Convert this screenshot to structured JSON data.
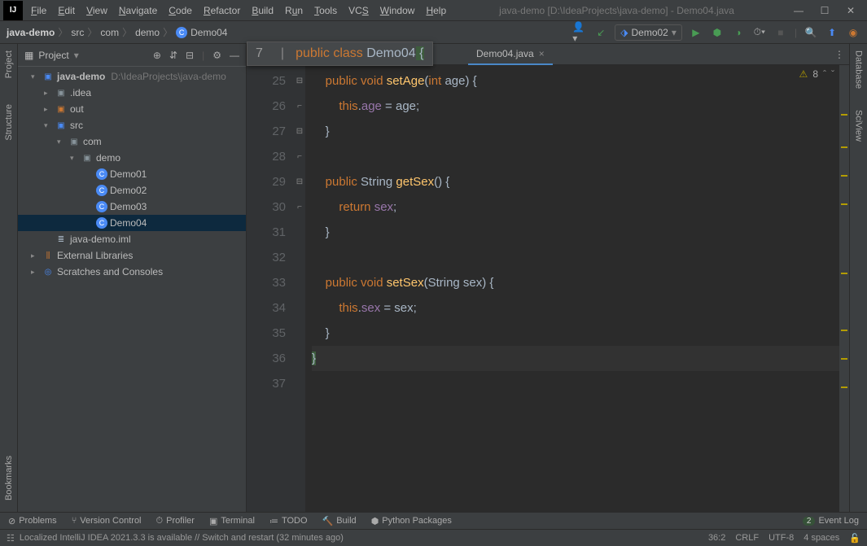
{
  "window": {
    "title": "java-demo [D:\\IdeaProjects\\java-demo] - Demo04.java"
  },
  "menu": [
    "File",
    "Edit",
    "View",
    "Navigate",
    "Code",
    "Refactor",
    "Build",
    "Run",
    "Tools",
    "VCS",
    "Window",
    "Help"
  ],
  "breadcrumb": {
    "project": "java-demo",
    "src": "src",
    "pkg1": "com",
    "pkg2": "demo",
    "cls": "Demo04"
  },
  "runConfig": "Demo02",
  "leftTabs": [
    "Project",
    "Structure",
    "Bookmarks"
  ],
  "rightTabs": [
    "Database",
    "SciView"
  ],
  "projectPanel": {
    "title": "Project",
    "root": {
      "name": "java-demo",
      "path": "D:\\IdeaProjects\\java-demo"
    },
    "idea": ".idea",
    "out": "out",
    "src": "src",
    "com": "com",
    "demo": "demo",
    "classes": [
      "Demo01",
      "Demo02",
      "Demo03",
      "Demo04"
    ],
    "iml": "java-demo.iml",
    "extlib": "External Libraries",
    "scratches": "Scratches and Consoles"
  },
  "editor": {
    "tab": "Demo04.java",
    "overlayLine": "7",
    "lines": [
      25,
      26,
      27,
      28,
      29,
      30,
      31,
      32,
      33,
      34,
      35,
      36,
      37
    ]
  },
  "code": {
    "overlay": {
      "pre": "public class ",
      "name": "Demo04",
      "post": " {"
    },
    "l25": {
      "a": "public void ",
      "b": "setAge",
      "c": "(",
      "d": "int ",
      "e": "age) {"
    },
    "l26": {
      "a": "this",
      "b": ".",
      "c": "age",
      "d": " = age;"
    },
    "l27": "}",
    "l29": {
      "a": "public ",
      "b": "String ",
      "c": "getSex",
      "d": "() {"
    },
    "l30": {
      "a": "return ",
      "b": "sex",
      "c": ";"
    },
    "l31": "}",
    "l33": {
      "a": "public void ",
      "b": "setSex",
      "c": "(String sex) {"
    },
    "l34": {
      "a": "this",
      "b": ".",
      "c": "sex",
      "d": " = sex;"
    },
    "l35": "}",
    "l36": "}"
  },
  "inspection": {
    "count": "8"
  },
  "bottomTools": {
    "problems": "Problems",
    "vcs": "Version Control",
    "profiler": "Profiler",
    "terminal": "Terminal",
    "todo": "TODO",
    "build": "Build",
    "python": "Python Packages",
    "eventLog": "Event Log",
    "eventBadge": "2"
  },
  "status": {
    "msg": "Localized IntelliJ IDEA 2021.3.3 is available // Switch and restart (32 minutes ago)",
    "pos": "36:2",
    "sep": "CRLF",
    "enc": "UTF-8",
    "indent": "4 spaces"
  }
}
